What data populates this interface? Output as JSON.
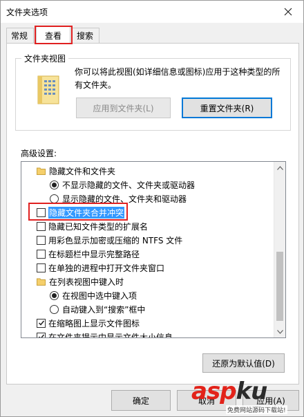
{
  "window": {
    "title": "文件夹选项"
  },
  "tabs": [
    {
      "label": "常规",
      "active": false
    },
    {
      "label": "查看",
      "active": true
    },
    {
      "label": "搜索",
      "active": false
    }
  ],
  "folder_views": {
    "legend": "文件夹视图",
    "description": "你可以将此视图(如详细信息或图标)应用于这种类型的所有文件夹。",
    "apply_label": "应用到文件夹(L)",
    "reset_label": "重置文件夹(R)"
  },
  "advanced": {
    "label": "高级设置:",
    "items": [
      {
        "kind": "folder",
        "label": "隐藏文件和文件夹"
      },
      {
        "kind": "radio",
        "checked": true,
        "label": "不显示隐藏的文件、文件夹或驱动器"
      },
      {
        "kind": "radio",
        "checked": false,
        "label": "显示隐藏的文件、文件夹和驱动器"
      },
      {
        "kind": "checkbox",
        "checked": false,
        "label": "隐藏文件夹合并冲突",
        "highlighted": true
      },
      {
        "kind": "checkbox",
        "checked": false,
        "label": "隐藏已知文件类型的扩展名"
      },
      {
        "kind": "checkbox",
        "checked": false,
        "label": "用彩色显示加密或压缩的 NTFS 文件"
      },
      {
        "kind": "checkbox",
        "checked": false,
        "label": "在标题栏中显示完整路径"
      },
      {
        "kind": "checkbox",
        "checked": false,
        "label": "在单独的进程中打开文件夹窗口"
      },
      {
        "kind": "folder",
        "label": "在列表视图中键入时"
      },
      {
        "kind": "radio",
        "checked": true,
        "label": "在视图中选中键入项"
      },
      {
        "kind": "radio",
        "checked": false,
        "label": "自动键入到“搜索”框中"
      },
      {
        "kind": "checkbox",
        "checked": true,
        "label": "在缩略图上显示文件图标"
      },
      {
        "kind": "checkbox",
        "checked": true,
        "label": "在文件夹提示中显示文件大小信息"
      }
    ]
  },
  "restore_defaults_label": "还原为默认值(D)",
  "footer": {
    "ok_label": "确定",
    "cancel_label": "取消",
    "apply_label": "应用(A)"
  },
  "watermark": {
    "brand": "aspku",
    "sub": "免费网站源码下载站!"
  },
  "colors": {
    "highlight": "#3399ff",
    "annotation_red": "#e02020",
    "focus_blue": "#0078d7",
    "watermark_red": "#e2231a"
  }
}
